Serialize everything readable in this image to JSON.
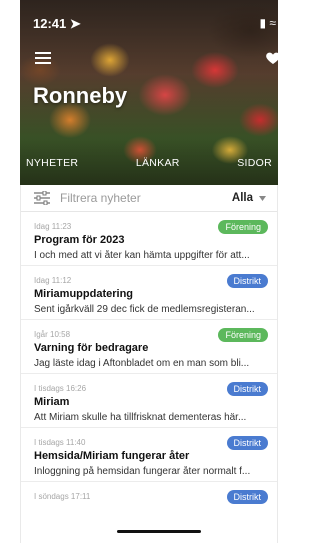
{
  "status_bar": {
    "time": "12:41",
    "signal": "▮ ≈"
  },
  "header": {
    "title": "Ronneby"
  },
  "tabs": [
    {
      "label": "NYHETER",
      "active": true
    },
    {
      "label": "LÄNKAR",
      "active": false
    },
    {
      "label": "SIDOR",
      "active": false
    }
  ],
  "filter": {
    "placeholder": "Filtrera nyheter",
    "selected": "Alla"
  },
  "colors": {
    "accent": "#e5533a",
    "green_badge": "#5cb85c",
    "blue_badge": "#4a7bd0"
  },
  "news": [
    {
      "time": "Idag 11:23",
      "title": "Program för 2023",
      "snippet": "I och med att vi åter kan hämta uppgifter för att...",
      "badge": "Förening",
      "badge_color": "green"
    },
    {
      "time": "Idag 11:12",
      "title": "Miriamuppdatering",
      "snippet": "Sent igårkväll 29 dec fick de medlemsregisteran...",
      "badge": "Distrikt",
      "badge_color": "blue"
    },
    {
      "time": "Igår 10:58",
      "title": "Varning för bedragare",
      "snippet": "Jag läste idag i Aftonbladet om en man som bli...",
      "badge": "Förening",
      "badge_color": "green"
    },
    {
      "time": "I tisdags 16:26",
      "title": "Miriam",
      "snippet": "Att Miriam skulle ha tillfrisknat dementeras här...",
      "badge": "Distrikt",
      "badge_color": "blue"
    },
    {
      "time": "I tisdags 11:40",
      "title": "Hemsida/Miriam fungerar åter",
      "snippet": "Inloggning på hemsidan fungerar åter normalt f...",
      "badge": "Distrikt",
      "badge_color": "blue"
    },
    {
      "time": "I söndags 17:11",
      "title": "",
      "snippet": "",
      "badge": "Distrikt",
      "badge_color": "blue"
    }
  ]
}
